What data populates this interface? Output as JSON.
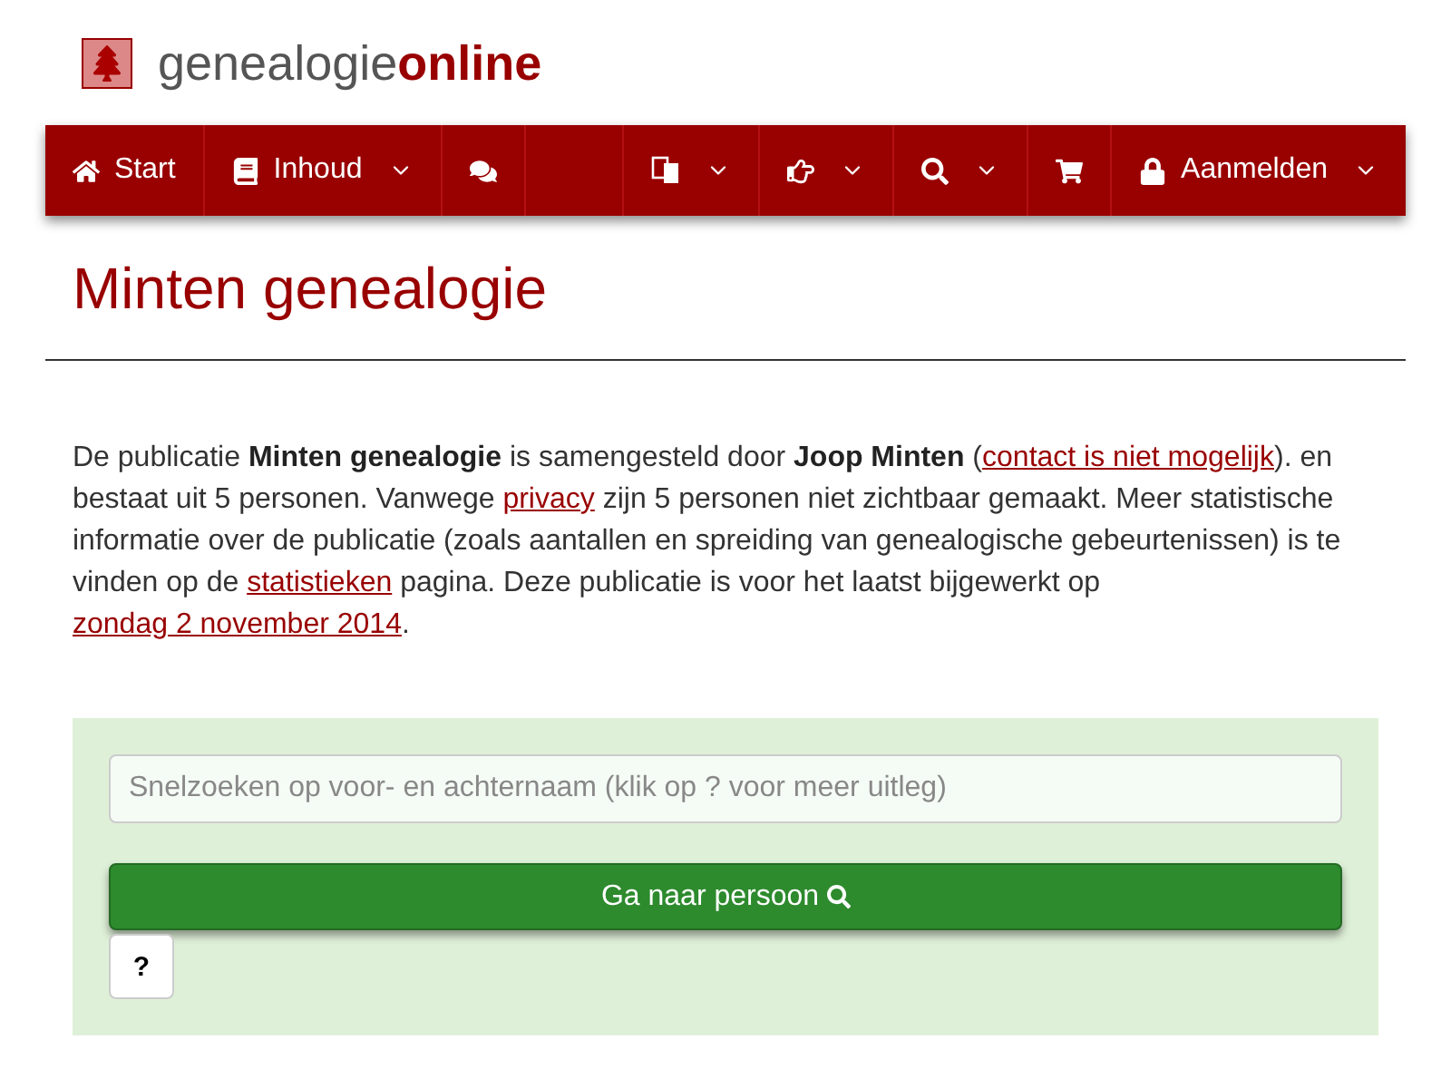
{
  "logo": {
    "text": "genealogie**online**"
  },
  "nav_left": [
    {
      "kind": "home",
      "label": "Start",
      "caret": false
    },
    {
      "kind": "book",
      "label": "Inhoud",
      "caret": true
    },
    {
      "kind": "comments",
      "caret": false
    }
  ],
  "nav_right": [
    {
      "kind": "language",
      "caret": true
    },
    {
      "kind": "hand",
      "caret": true
    },
    {
      "kind": "search",
      "caret": true
    },
    {
      "kind": "cart",
      "caret": false
    },
    {
      "kind": "lock",
      "label": "Aanmelden",
      "caret": true
    }
  ],
  "heading": "Minten genealogie",
  "intro": [
    {
      "kind": "text",
      "text": "De publicatie "
    },
    {
      "kind": "bold",
      "text": "Minten genealogie"
    },
    {
      "kind": "text",
      "text": " is samengesteld door "
    },
    {
      "kind": "bold",
      "text": "Joop Minten"
    },
    {
      "kind": "text",
      "text": " ("
    },
    {
      "kind": "link",
      "text": "contact is niet mogelijk"
    },
    {
      "kind": "text",
      "text": "). en bestaat uit 5 personen. Vanwege "
    },
    {
      "kind": "link",
      "text": "privacy"
    },
    {
      "kind": "text",
      "text": " zijn 5 personen niet zichtbaar gemaakt. Meer statistische informatie over de publicatie (zoals aantallen en spreiding van genealogische gebeurtenissen) is te vinden op de "
    },
    {
      "kind": "link",
      "text": "statistieken"
    },
    {
      "kind": "text",
      "text": " pagina. Deze publicatie is voor het laatst bijgewerkt op "
    },
    {
      "kind": "link",
      "text": "zondag 2 november 2014"
    },
    {
      "kind": "text",
      "text": "."
    }
  ],
  "search": {
    "placeholder": "Snelzoeken op voor- en achternaam (klik op ? voor meer uitleg)",
    "button": "Ga naar persoon",
    "help": "?"
  }
}
